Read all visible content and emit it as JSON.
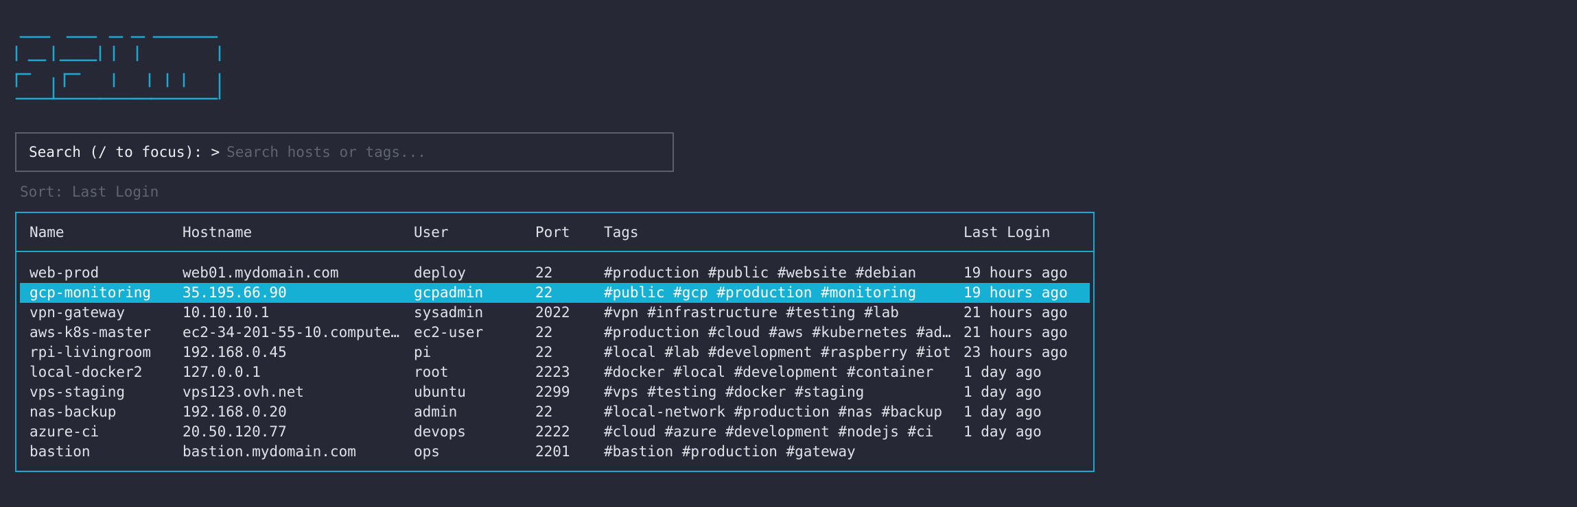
{
  "search": {
    "label": "Search (/ to focus): >",
    "value": "",
    "placeholder": "Search hosts or tags..."
  },
  "sort": {
    "text": "Sort: Last Login"
  },
  "table": {
    "columns": [
      "Name",
      "Hostname",
      "User",
      "Port",
      "Tags",
      "Last Login"
    ],
    "selected_index": 1,
    "rows": [
      {
        "name": "web-prod",
        "hostname": "web01.mydomain.com",
        "user": "deploy",
        "port": "22",
        "tags": "#production #public #website #debian",
        "last_login": "19 hours ago"
      },
      {
        "name": "gcp-monitoring",
        "hostname": "35.195.66.90",
        "user": "gcpadmin",
        "port": "22",
        "tags": "#public #gcp #production #monitoring",
        "last_login": "19 hours ago"
      },
      {
        "name": "vpn-gateway",
        "hostname": "10.10.10.1",
        "user": "sysadmin",
        "port": "2022",
        "tags": "#vpn #infrastructure #testing #lab",
        "last_login": "21 hours ago"
      },
      {
        "name": "aws-k8s-master",
        "hostname": "ec2-34-201-55-10.compute…",
        "user": "ec2-user",
        "port": "22",
        "tags": "#production #cloud #aws #kubernetes #ad…",
        "last_login": "21 hours ago"
      },
      {
        "name": "rpi-livingroom",
        "hostname": "192.168.0.45",
        "user": "pi",
        "port": "22",
        "tags": "#local #lab #development #raspberry #iot",
        "last_login": "23 hours ago"
      },
      {
        "name": "local-docker2",
        "hostname": "127.0.0.1",
        "user": "root",
        "port": "2223",
        "tags": "#docker #local #development #container",
        "last_login": "1 day ago"
      },
      {
        "name": "vps-staging",
        "hostname": "vps123.ovh.net",
        "user": "ubuntu",
        "port": "2299",
        "tags": "#vps #testing #docker #staging",
        "last_login": "1 day ago"
      },
      {
        "name": "nas-backup",
        "hostname": "192.168.0.20",
        "user": "admin",
        "port": "22",
        "tags": "#local-network #production #nas #backup",
        "last_login": "1 day ago"
      },
      {
        "name": "azure-ci",
        "hostname": "20.50.120.77",
        "user": "devops",
        "port": "2222",
        "tags": "#cloud #azure #development #nodejs #ci",
        "last_login": "1 day ago"
      },
      {
        "name": "bastion",
        "hostname": "bastion.mydomain.com",
        "user": "ops",
        "port": "2201",
        "tags": "#bastion #production #gateway",
        "last_login": ""
      }
    ]
  },
  "colors": {
    "background": "#262935",
    "accent": "#1ba9d1",
    "selected_row": "#15b0d4",
    "dim_text": "#5f6372"
  }
}
